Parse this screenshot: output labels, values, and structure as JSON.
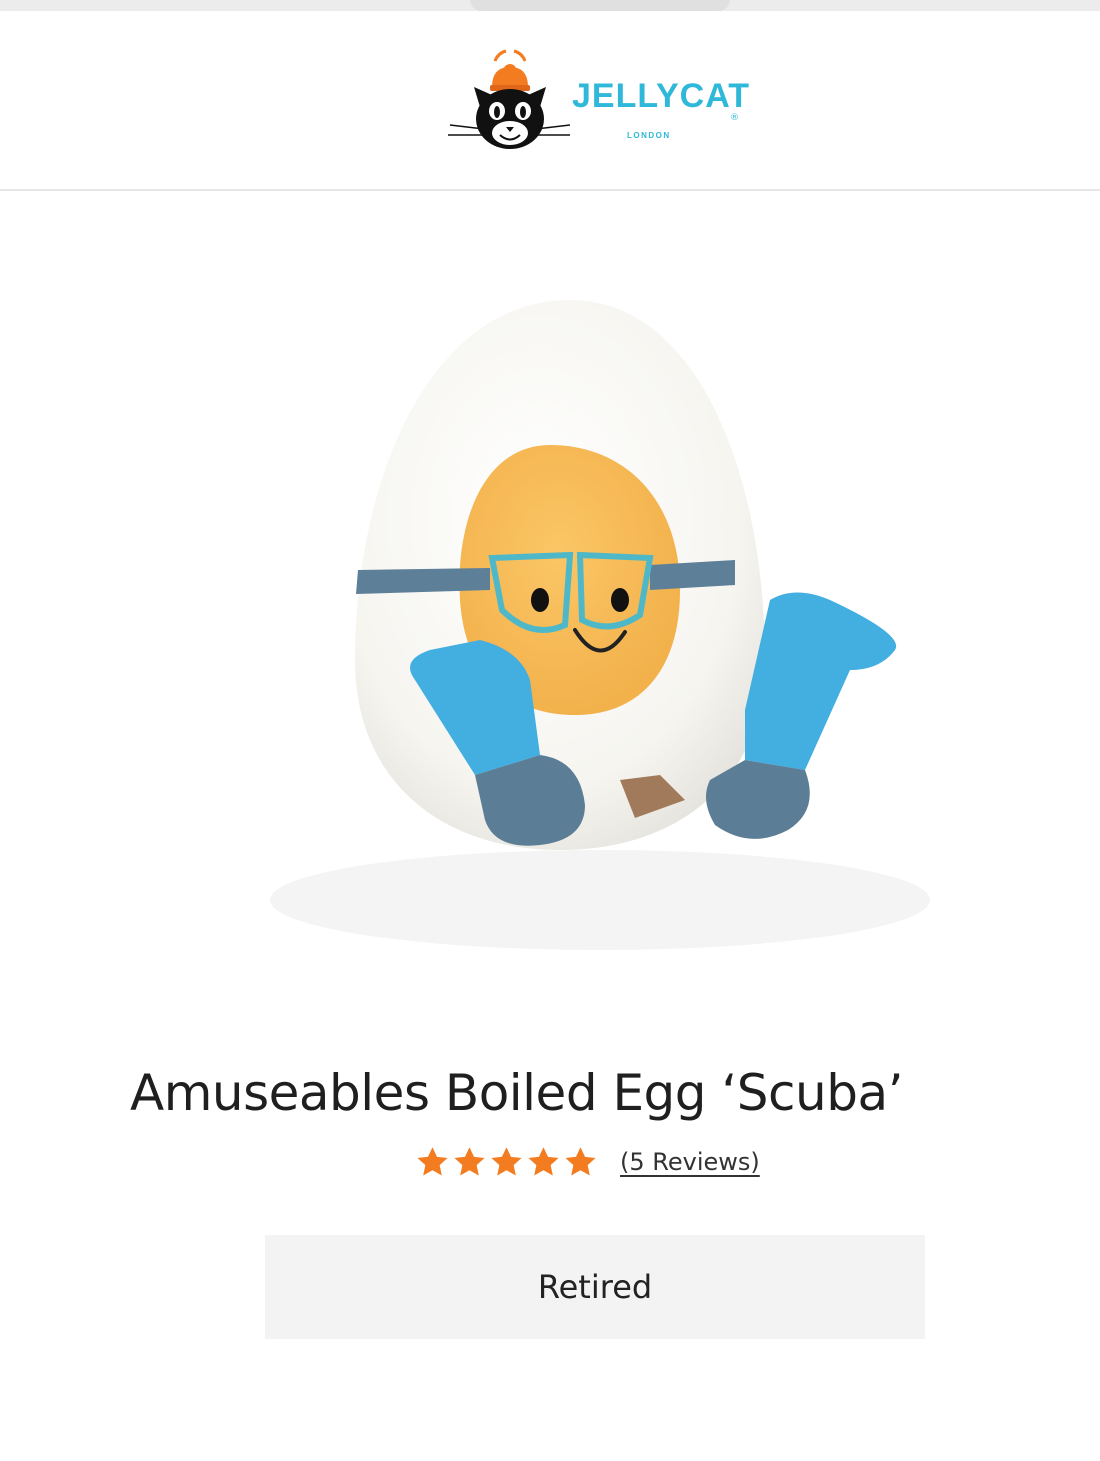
{
  "header": {
    "brand_name": "JELLYCAT",
    "brand_sub": "LONDON",
    "registered_mark": "®",
    "brand_color": "#2fb8d9"
  },
  "product": {
    "image_alt": "Amuseables Boiled Egg ‘Scuba’ plush toy",
    "title": "Amuseables Boiled Egg ‘Scuba’",
    "rating": {
      "stars": 5,
      "max_stars": 5,
      "star_color": "#f47c20",
      "reviews_label": "(5 Reviews)"
    },
    "status_label": "Retired"
  }
}
